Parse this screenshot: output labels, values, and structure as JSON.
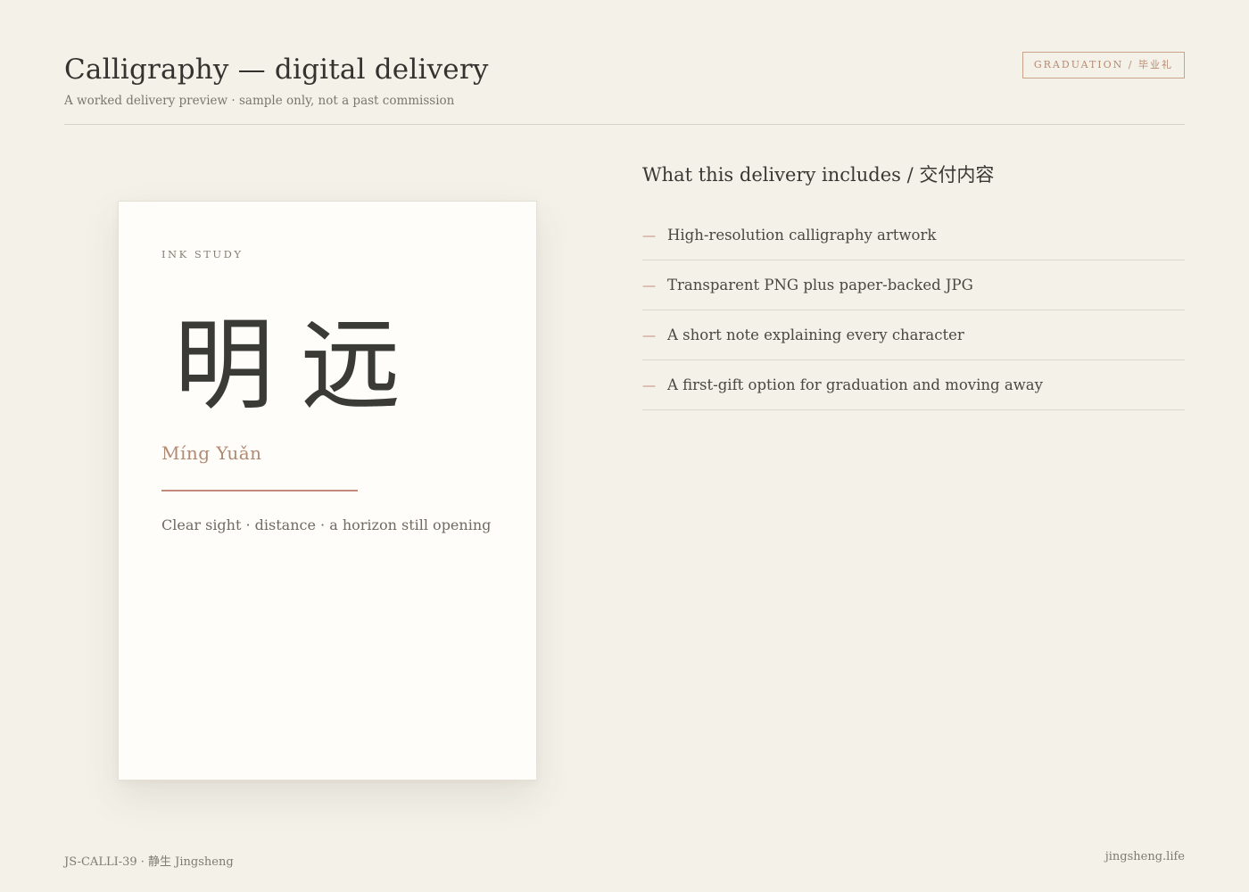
{
  "header": {
    "title": "Calligraphy — digital delivery",
    "subtitle": "A worked delivery preview · sample only, not a past commission",
    "badge": "GRADUATION / 毕业礼"
  },
  "card": {
    "eyebrow": "INK STUDY",
    "hanzi": "明远",
    "pinyin": "Míng Yuǎn",
    "meaning": "Clear sight · distance · a horizon still opening"
  },
  "includes": {
    "title": "What this delivery includes / 交付内容",
    "items": [
      {
        "label": "High-resolution calligraphy artwork"
      },
      {
        "label": "Transparent PNG plus paper-backed JPG"
      },
      {
        "label": "A short note explaining every character"
      },
      {
        "label": "A first-gift option for graduation and moving away"
      }
    ]
  },
  "footer": {
    "left": "JS-CALLI-39 · 静生 Jingsheng",
    "right": "jingsheng.life"
  },
  "colors": {
    "background": "#f4f1e9",
    "card": "#fefdf9",
    "accent": "#c3897a",
    "pinyin": "#b28972"
  }
}
